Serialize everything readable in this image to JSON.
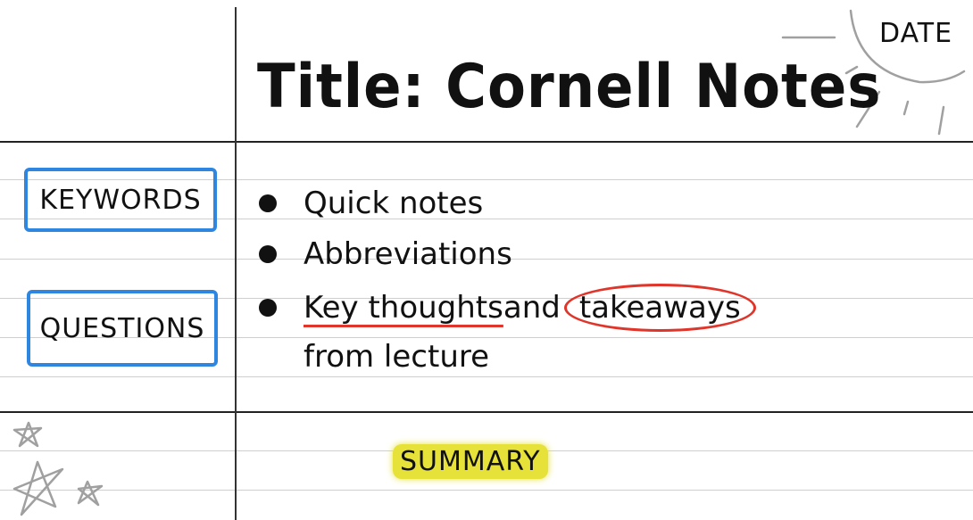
{
  "header": {
    "title": "Title: Cornell Notes",
    "date_label": "DATE"
  },
  "cues": [
    {
      "label": "KEYWORDS"
    },
    {
      "label": "QUESTIONS"
    }
  ],
  "notes": {
    "bullets": [
      "Quick notes",
      "Abbreviations"
    ],
    "third": {
      "underlined": "Key thoughts",
      "middle": " and",
      "circled": "takeaways",
      "continuation": "from lecture"
    }
  },
  "summary": {
    "label": "SUMMARY"
  },
  "colors": {
    "cue_box": "#2f86e0",
    "annotation_red": "#e0352a",
    "highlight": "#e6e23a",
    "doodle_gray": "#a0a0a0"
  },
  "icons": [
    "sun-doodle-icon",
    "star-doodle-icon"
  ]
}
